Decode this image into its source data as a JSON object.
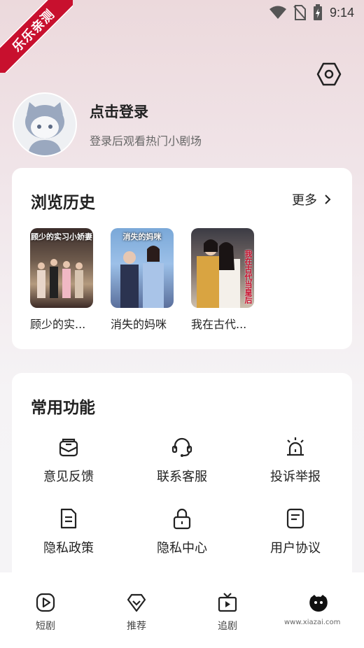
{
  "status_bar": {
    "time": "9:14"
  },
  "ribbon": {
    "text": "乐乐亲测"
  },
  "profile": {
    "title": "点击登录",
    "subtitle": "登录后观看热门小剧场"
  },
  "history": {
    "title": "浏览历史",
    "more_label": "更多",
    "items": [
      {
        "name": "顾少的实...",
        "poster_text": "顾少的实习小娇妻"
      },
      {
        "name": "消失的妈咪",
        "poster_text": "消失的妈咪"
      },
      {
        "name": "我在古代...",
        "poster_text": "我在古代当皇后"
      }
    ]
  },
  "functions": {
    "title": "常用功能",
    "items": [
      {
        "label": "意见反馈",
        "icon": "feedback-icon"
      },
      {
        "label": "联系客服",
        "icon": "headset-icon"
      },
      {
        "label": "投诉举报",
        "icon": "alarm-icon"
      },
      {
        "label": "隐私政策",
        "icon": "document-icon"
      },
      {
        "label": "隐私中心",
        "icon": "lock-icon"
      },
      {
        "label": "用户协议",
        "icon": "agreement-icon"
      }
    ]
  },
  "tabs": [
    {
      "label": "短剧",
      "icon": "play-circle-icon"
    },
    {
      "label": "推荐",
      "icon": "diamond-heart-icon"
    },
    {
      "label": "追剧",
      "icon": "tv-icon"
    },
    {
      "label": "",
      "icon": "profile-face-icon"
    }
  ],
  "watermark": {
    "text": "www.xiazai.com"
  },
  "colors": {
    "accent": "#111111",
    "ribbon": "#c8102e"
  }
}
